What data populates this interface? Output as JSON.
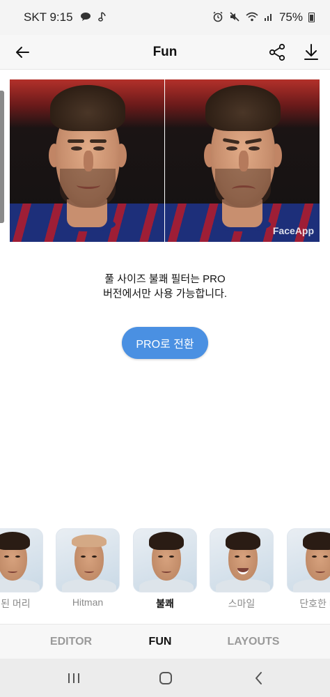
{
  "status_bar": {
    "carrier_time": "SKT 9:15",
    "battery_percent": "75%",
    "icons": [
      "message-bubble-icon",
      "music-note-icon",
      "alarm-icon",
      "mute-icon",
      "wifi-icon",
      "signal-icon",
      "battery-icon"
    ]
  },
  "header": {
    "title": "Fun",
    "icons": [
      "back-arrow-icon",
      "share-icon",
      "download-icon"
    ]
  },
  "comparison": {
    "watermark": "FaceApp"
  },
  "message": {
    "line1": "풀 사이즈 불쾌 필터는 PRO",
    "line2": "버전에서만 사용 가능합니다.",
    "button_label": "PRO로 전환"
  },
  "filters": [
    {
      "label": "색된 머리",
      "active": false
    },
    {
      "label": "Hitman",
      "active": false
    },
    {
      "label": "불쾌",
      "active": true
    },
    {
      "label": "스마일",
      "active": false
    },
    {
      "label": "단호한 머",
      "active": false
    }
  ],
  "tabs": [
    {
      "label": "EDITOR",
      "active": false
    },
    {
      "label": "FUN",
      "active": true
    },
    {
      "label": "LAYOUTS",
      "active": false
    }
  ],
  "nav": {
    "icons": [
      "recents-icon",
      "home-icon",
      "back-icon"
    ]
  },
  "colors": {
    "accent": "#4a90e2",
    "active_tab": "#111111",
    "inactive_tab": "#9a9a9a"
  }
}
